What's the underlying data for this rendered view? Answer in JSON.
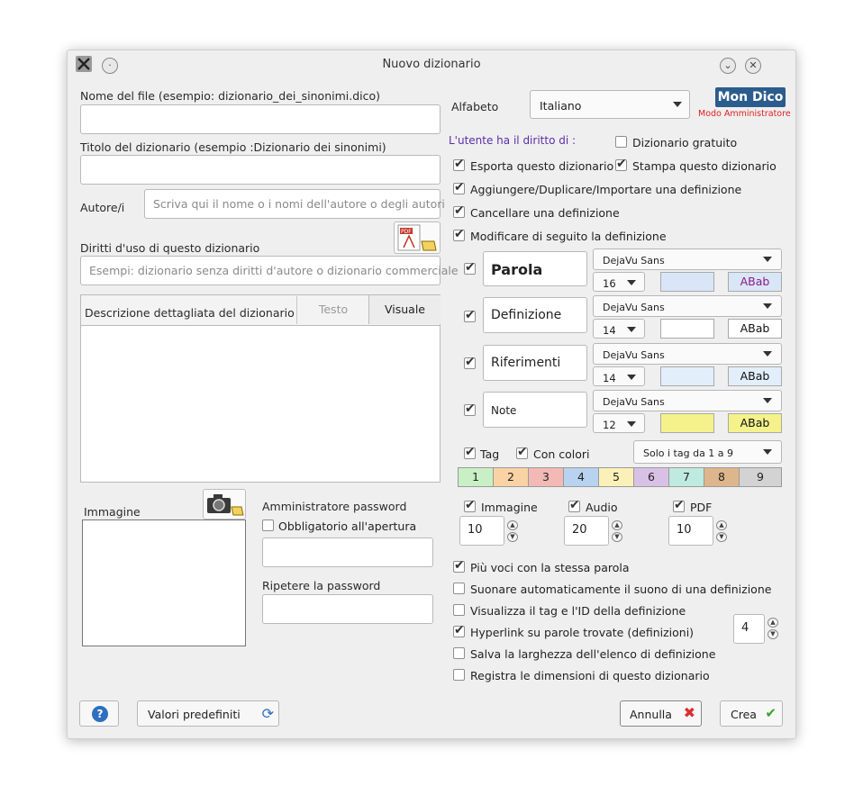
{
  "window": {
    "title": "Nuovo dizionario"
  },
  "left": {
    "filename": {
      "label": "Nome del file (esempio: dizionario_dei_sinonimi.dico)",
      "value": ""
    },
    "dict_title": {
      "label": "Titolo del dizionario (esempio :Dizionario dei sinonimi)",
      "value": ""
    },
    "authors": {
      "label": "Autore/i",
      "placeholder": "Scriva qui il nome o i nomi dell'autore o degli autori"
    },
    "rights": {
      "label": "Diritti d'uso di questo dizionario",
      "placeholder": "Esempi: dizionario senza diritti d'autore o dizionario commerciale"
    },
    "description": {
      "label": "Descrizione dettagliata del dizionario",
      "tab_text": "Testo",
      "tab_visual": "Visuale"
    },
    "image_label": "Immagine",
    "admin_password_label": "Amministratore password",
    "mandatory_label": "Obbligatorio all'apertura",
    "repeat_password_label": "Ripetere la password"
  },
  "right": {
    "alphabet": {
      "label": "Alfabeto",
      "value": "Italiano"
    },
    "logo": {
      "title": "Mon Dico",
      "subtitle": "Modo Amministratore"
    },
    "rights_header": "L'utente ha il diritto di :",
    "free_dict": {
      "label": "Dizionario gratuito",
      "checked": false
    },
    "export": {
      "label": "Esporta questo dizionario",
      "checked": true
    },
    "print": {
      "label": "Stampa questo dizionario",
      "checked": true
    },
    "add": {
      "label": "Aggiungere/Duplicare/Importare una definizione",
      "checked": true
    },
    "delete": {
      "label": "Cancellare una definizione",
      "checked": true
    },
    "modify": {
      "label": "Modificare di seguito la definizione",
      "checked": true
    },
    "fields": [
      {
        "name": "Parola",
        "font": "DejaVu Sans",
        "size": "16",
        "bg": "#d9e6f7",
        "sample": "ABab",
        "sample_bg": "#d9e6f7",
        "sample_color": "#8a1a8a"
      },
      {
        "name": "Definizione",
        "font": "DejaVu Sans",
        "size": "14",
        "bg": "#ffffff",
        "sample": "ABab",
        "sample_bg": "#ffffff",
        "sample_color": "#111111"
      },
      {
        "name": "Riferimenti",
        "font": "DejaVu Sans",
        "size": "14",
        "bg": "#e3eefb",
        "sample": "ABab",
        "sample_bg": "#e3eefb",
        "sample_color": "#111111"
      },
      {
        "name": "Note",
        "font": "DejaVu Sans",
        "size": "12",
        "bg": "#f5f28c",
        "sample": "ABab",
        "sample_bg": "#f5f28c",
        "sample_color": "#111111"
      }
    ],
    "tag": {
      "label": "Tag",
      "checked": true
    },
    "colors": {
      "label": "Con colori",
      "checked": true
    },
    "tag_range": "Solo i tag da 1 a 9",
    "tags": [
      {
        "n": "1",
        "color": "#c9f0c4"
      },
      {
        "n": "2",
        "color": "#f9d3a3"
      },
      {
        "n": "3",
        "color": "#f3b9b4"
      },
      {
        "n": "4",
        "color": "#b7d3ef"
      },
      {
        "n": "5",
        "color": "#fbf1b8"
      },
      {
        "n": "6",
        "color": "#d9c1e6"
      },
      {
        "n": "7",
        "color": "#bfeadf"
      },
      {
        "n": "8",
        "color": "#deb68c"
      },
      {
        "n": "9",
        "color": "#d3d3d3"
      }
    ],
    "media": [
      {
        "label": "Immagine",
        "checked": true,
        "value": "10"
      },
      {
        "label": "Audio",
        "checked": true,
        "value": "20"
      },
      {
        "label": "PDF",
        "checked": true,
        "value": "10"
      }
    ],
    "options": [
      {
        "label": "Più voci con la stessa parola",
        "checked": true
      },
      {
        "label": "Suonare automaticamente il suono di una definizione",
        "checked": false
      },
      {
        "label": "Visualizza il tag e l'ID della definizione",
        "checked": false
      },
      {
        "label": "Hyperlink su parole trovate (definizioni)",
        "checked": true
      },
      {
        "label": "Salva la larghezza dell'elenco di definizione",
        "checked": false
      },
      {
        "label": "Registra le dimensioni di questo dizionario",
        "checked": false
      }
    ],
    "hyperlink_value": "4"
  },
  "footer": {
    "defaults_label": "Valori predefiniti",
    "cancel_label": "Annulla",
    "create_label": "Crea"
  }
}
